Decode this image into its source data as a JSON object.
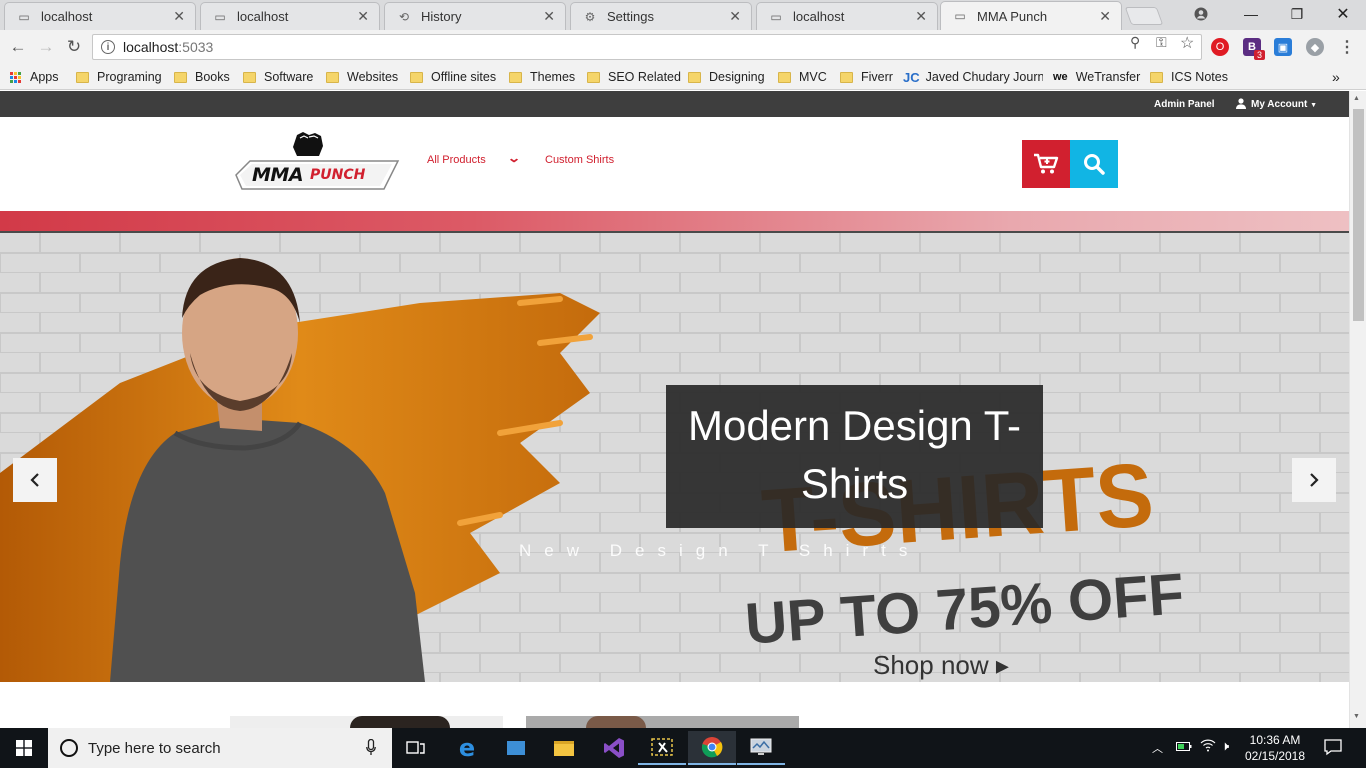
{
  "browser": {
    "tabs": [
      {
        "title": "localhost",
        "icon": "page-icon"
      },
      {
        "title": "localhost",
        "icon": "page-icon"
      },
      {
        "title": "History",
        "icon": "history-icon"
      },
      {
        "title": "Settings",
        "icon": "gear-icon"
      },
      {
        "title": "localhost",
        "icon": "page-icon"
      },
      {
        "title": "MMA Punch",
        "icon": "page-icon"
      }
    ],
    "url_host": "localhost",
    "url_port": ":5033",
    "bookmarks": [
      {
        "label": "Apps",
        "icon": "apps-grid-icon"
      },
      {
        "label": "Programing",
        "icon": "folder-icon"
      },
      {
        "label": "Books",
        "icon": "folder-icon"
      },
      {
        "label": "Software",
        "icon": "folder-icon"
      },
      {
        "label": "Websites",
        "icon": "folder-icon"
      },
      {
        "label": "Offline sites",
        "icon": "folder-icon"
      },
      {
        "label": "Themes",
        "icon": "folder-icon"
      },
      {
        "label": "SEO Related",
        "icon": "folder-icon"
      },
      {
        "label": "Designing",
        "icon": "folder-icon"
      },
      {
        "label": "MVC",
        "icon": "folder-icon"
      },
      {
        "label": "Fiverr",
        "icon": "folder-icon"
      },
      {
        "label": "Javed Chudary Journa",
        "icon": "jc-logo-icon"
      },
      {
        "label": "WeTransfer",
        "icon": "we-logo-icon"
      },
      {
        "label": "ICS Notes",
        "icon": "folder-icon"
      }
    ],
    "extension_badge": "3"
  },
  "site": {
    "topbar": {
      "admin_panel": "Admin Panel",
      "my_account": "My Account"
    },
    "logo": {
      "main": "MMA",
      "sub": "PUNCH"
    },
    "nav": {
      "all_products": "All Products",
      "custom_shirts": "Custom Shirts"
    },
    "colors": {
      "brand_red": "#d1202f",
      "search_blue": "#11b5e4",
      "topbar": "#3e3e3e"
    },
    "hero": {
      "caption_title": "Modern Design T-Shirts",
      "caption_sub": "New Design T Shirts",
      "banner_headline": "T-SHIRTS",
      "banner_offer": "UP TO 75% OFF",
      "banner_cta": "Shop now ▸"
    }
  },
  "taskbar": {
    "search_placeholder": "Type here to search",
    "time": "10:36 AM",
    "date": "02/15/2018"
  }
}
